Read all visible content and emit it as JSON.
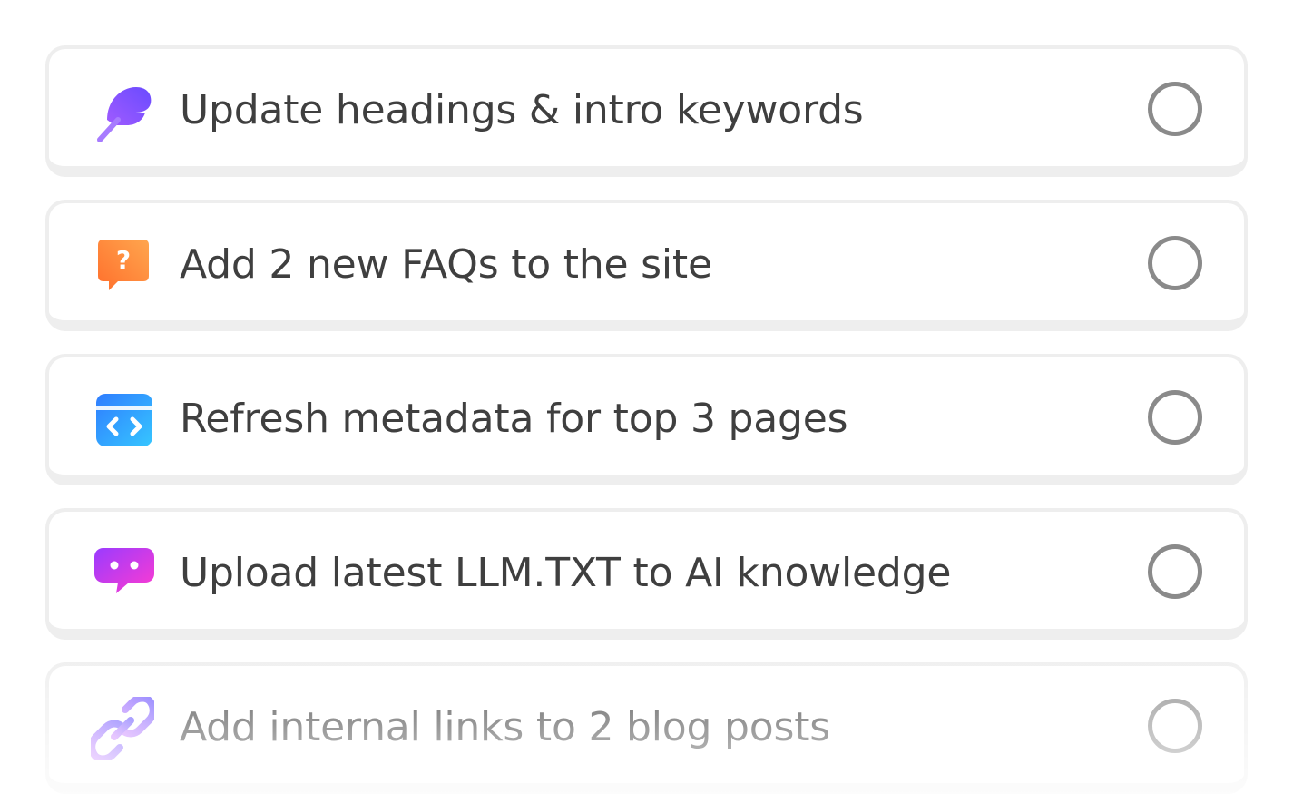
{
  "tasks": [
    {
      "label": "Update headings & intro keywords",
      "icon": "feather-pen-icon",
      "done": false
    },
    {
      "label": "Add 2 new FAQs to the site",
      "icon": "question-chat-icon",
      "done": false
    },
    {
      "label": "Refresh metadata for top 3 pages",
      "icon": "code-window-icon",
      "done": false
    },
    {
      "label": "Upload latest LLM.TXT to AI knowledge",
      "icon": "chat-bubble-icon",
      "done": false
    },
    {
      "label": "Add internal links to 2 blog posts",
      "icon": "link-icon",
      "done": false
    }
  ],
  "colors": {
    "text": "#3f3f3f",
    "card_border": "#eeeeee",
    "checkbox_border": "#8a8a8a",
    "feather_gradient": [
      "#7b61ff",
      "#c34dff"
    ],
    "faq_gradient": [
      "#ff7a2f",
      "#ffa24d"
    ],
    "code_gradient": [
      "#2f8bff",
      "#36c2ff"
    ],
    "chat_gradient": [
      "#a23bff",
      "#ff3bd4"
    ],
    "link_gradient": [
      "#6c5cff",
      "#c86bff"
    ]
  }
}
